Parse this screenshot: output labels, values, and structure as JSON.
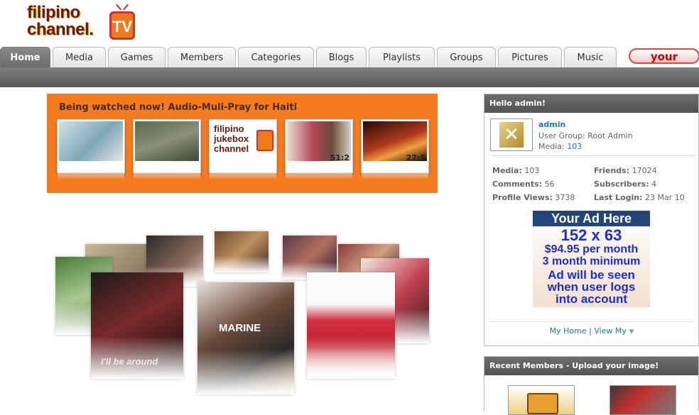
{
  "logo": {
    "line1": "filipino",
    "line2": "channel.",
    "tv": "TV"
  },
  "nav": {
    "tabs": [
      {
        "label": "Home",
        "active": true
      },
      {
        "label": "Media"
      },
      {
        "label": "Games"
      },
      {
        "label": "Members"
      },
      {
        "label": "Categories"
      },
      {
        "label": "Blogs"
      },
      {
        "label": "Playlists"
      },
      {
        "label": "Groups"
      },
      {
        "label": "Pictures"
      },
      {
        "label": "Music"
      }
    ],
    "your_button": "your"
  },
  "watched": {
    "title": "Being watched now! Audio-Muli-Pray for Haiti",
    "thumbs": [
      {
        "duration": ""
      },
      {
        "duration": ""
      },
      {
        "duration": ""
      },
      {
        "duration": "51:2"
      },
      {
        "duration": "27:5"
      }
    ]
  },
  "collage": {
    "poster_marine": "MARINE",
    "poster_text_1": "I'll be around"
  },
  "user_panel": {
    "title": "Hello admin!",
    "username": "admin",
    "user_group_label": "User Group:",
    "user_group": "Root Admin",
    "media_label": "Media:",
    "media_count": "103",
    "stats": {
      "media_label": "Media:",
      "media": "103",
      "friends_label": "Friends:",
      "friends": "17024",
      "comments_label": "Comments:",
      "comments": "56",
      "subscribers_label": "Subscribers:",
      "subscribers": "4",
      "profile_views_label": "Profile Views:",
      "profile_views": "3738",
      "last_login_label": "Last Login:",
      "last_login": "23 Mar 10"
    },
    "ad": {
      "head": "Your Ad Here",
      "size": "152 x 63",
      "price": "$94.95 per month",
      "min": "3 month minimum",
      "seen1": "Ad will be seen",
      "seen2": "when user logs",
      "seen3": "into account"
    },
    "links": {
      "my_home": "My Home",
      "sep": "|",
      "view_my": "View My"
    }
  },
  "recent_panel": {
    "title": "Recent Members - Upload your image!"
  },
  "colors": {
    "orange": "#f47b20",
    "nav_dark": "#5a5a5a",
    "link": "#2277aa"
  }
}
